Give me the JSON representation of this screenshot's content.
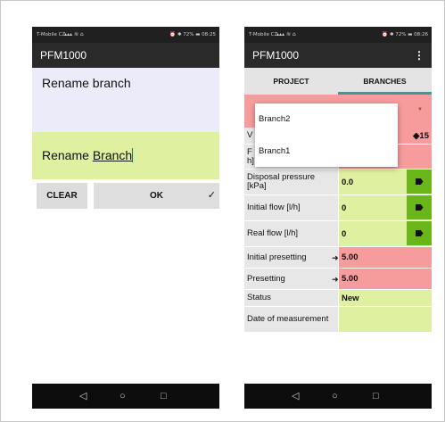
{
  "phone1": {
    "status": {
      "carrier": "T-Mobile CZ",
      "signal": "▴▴▴ ≋ ⌂",
      "right": "⏰ ✱ 72% ▬ 08:25"
    },
    "app_title": "PFM1000",
    "header_text": "Rename branch",
    "field_prefix": "Rename ",
    "field_edited": "Branch",
    "clear_label": "CLEAR",
    "ok_label": "OK",
    "ok_check": "✓"
  },
  "phone2": {
    "status": {
      "carrier": "T-Mobile CZ",
      "signal": "▴▴▴ ≋ ⌂",
      "right": "⏰ ✱ 72% ▬ 08:26"
    },
    "app_title": "PFM1000",
    "menu_glyph": "⋮",
    "tabs": [
      {
        "label": "PROJECT",
        "selected": false
      },
      {
        "label": "BRANCHES",
        "selected": true
      }
    ],
    "dropdown_items": [
      "Branch2",
      "Branch1"
    ],
    "rows": [
      {
        "label": "V",
        "value": "15",
        "value_prefix": "◆ ",
        "color": "red"
      },
      {
        "label": "F\nh]",
        "value": "",
        "color": "red"
      },
      {
        "label": "Disposal pressure [kPa]",
        "value": "0.0",
        "color": "green",
        "button": true
      },
      {
        "label": "Initial flow [l/h]",
        "value": "0",
        "color": "green",
        "button": true
      },
      {
        "label": "Real flow [l/h]",
        "value": "0",
        "color": "green",
        "button": true
      },
      {
        "label": "Initial presetting",
        "value": "5.00",
        "color": "red",
        "arrow": "➜"
      },
      {
        "label": "Presetting",
        "value": "5.00",
        "color": "red",
        "arrow": "➜"
      },
      {
        "label": "Status",
        "value": "New",
        "color": "green"
      },
      {
        "label": "Date of measurement",
        "value": "",
        "color": "green"
      }
    ]
  },
  "nav": {
    "back": "◁",
    "home": "○",
    "recent": "□"
  },
  "colors": {
    "green": "#dff0a0",
    "red": "#f69c9c",
    "accent": "#3f9a8c",
    "button_green": "#6ab519"
  }
}
